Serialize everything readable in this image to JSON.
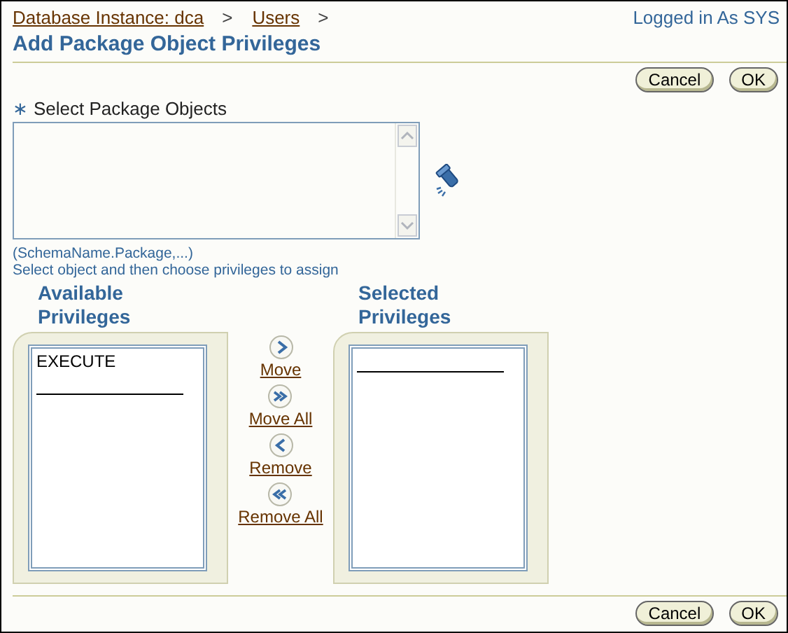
{
  "breadcrumbs": [
    {
      "label": "Database Instance: dca",
      "separator": ">"
    },
    {
      "label": "Users",
      "separator": ">"
    }
  ],
  "login_status": "Logged in As SYS",
  "title": "Add Package Object Privileges",
  "top_buttons": [
    "Cancel",
    "OK"
  ],
  "objects_field": {
    "required_mark": "∗",
    "label": "Select Package Objects",
    "hint": "(SchemaName.Package,...)"
  },
  "instruction": "Select object and then choose privileges to assign",
  "available": {
    "heading": "Available Privileges",
    "items": [
      "EXECUTE"
    ]
  },
  "selected": {
    "heading": "Selected Privileges"
  },
  "shuttle_actions": [
    {
      "kind": "move",
      "label": "Move"
    },
    {
      "kind": "move_all",
      "label": "Move All"
    },
    {
      "kind": "remove",
      "label": "Remove"
    },
    {
      "kind": "remove_all",
      "label": "Remove All"
    }
  ],
  "bottom_buttons": [
    "Cancel",
    "OK"
  ]
}
